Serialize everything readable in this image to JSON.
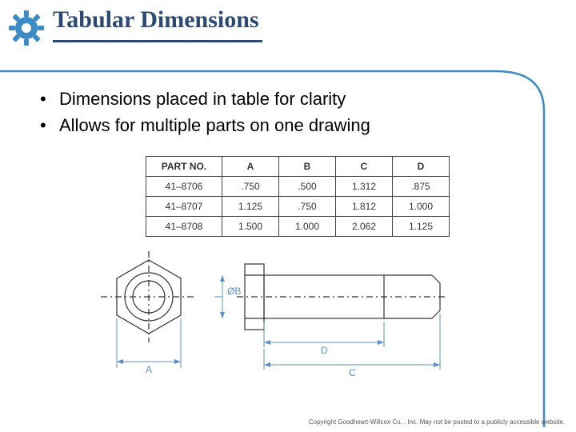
{
  "title": "Tabular Dimensions",
  "bullets": [
    "Dimensions placed in table for clarity",
    "Allows for multiple parts on one drawing"
  ],
  "tableHeaders": [
    "PART NO.",
    "A",
    "B",
    "C",
    "D"
  ],
  "tableRows": [
    {
      "part": "41–8706",
      "A": ".750",
      "B": ".500",
      "C": "1.312",
      "D": ".875"
    },
    {
      "part": "41–8707",
      "A": "1.125",
      "B": ".750",
      "C": "1.812",
      "D": "1.000"
    },
    {
      "part": "41–8708",
      "A": "1.500",
      "B": "1.000",
      "C": "2.062",
      "D": "1.125"
    }
  ],
  "dimLabels": {
    "A": "A",
    "B": "ØB",
    "C": "C",
    "D": "D"
  },
  "footer": "Copyright Goodheart-Willcox Co. , Inc.  May not be posted to a publicly accessible website."
}
